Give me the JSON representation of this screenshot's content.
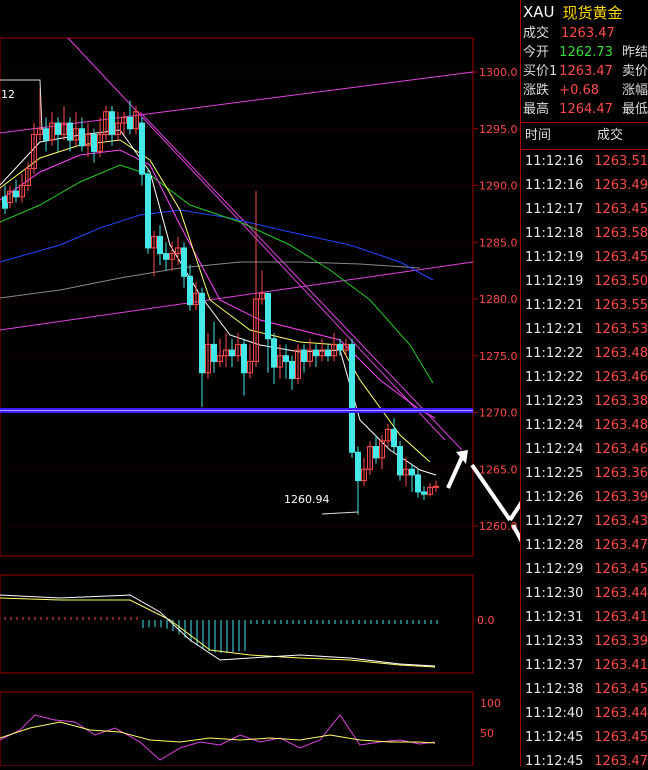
{
  "header": {
    "symbol": "XAU",
    "name": "现货黄金"
  },
  "quotes": [
    {
      "label": "成交",
      "value": "1263.47",
      "color": "red",
      "extra": ""
    },
    {
      "label": "今开",
      "value": "1262.73",
      "color": "green",
      "extra": "昨结"
    },
    {
      "label": "买价1",
      "value": "1263.47",
      "color": "red",
      "extra": "卖价"
    },
    {
      "label": "涨跌",
      "value": "+0.68",
      "color": "red",
      "extra": "涨幅"
    },
    {
      "label": "最高",
      "value": "1264.47",
      "color": "red",
      "extra": "最低"
    }
  ],
  "ticks_header": {
    "time": "时间",
    "price": "成交"
  },
  "ticks": [
    {
      "time": "11:12:16",
      "price": "1263.51"
    },
    {
      "time": "11:12:16",
      "price": "1263.49"
    },
    {
      "time": "11:12:17",
      "price": "1263.45"
    },
    {
      "time": "11:12:18",
      "price": "1263.58"
    },
    {
      "time": "11:12:19",
      "price": "1263.45"
    },
    {
      "time": "11:12:19",
      "price": "1263.50"
    },
    {
      "time": "11:12:21",
      "price": "1263.55"
    },
    {
      "time": "11:12:21",
      "price": "1263.53"
    },
    {
      "time": "11:12:22",
      "price": "1263.48"
    },
    {
      "time": "11:12:22",
      "price": "1263.46"
    },
    {
      "time": "11:12:23",
      "price": "1263.38"
    },
    {
      "time": "11:12:24",
      "price": "1263.48"
    },
    {
      "time": "11:12:24",
      "price": "1263.46"
    },
    {
      "time": "11:12:25",
      "price": "1263.36"
    },
    {
      "time": "11:12:26",
      "price": "1263.39"
    },
    {
      "time": "11:12:27",
      "price": "1263.43"
    },
    {
      "time": "11:12:28",
      "price": "1263.47"
    },
    {
      "time": "11:12:29",
      "price": "1263.45"
    },
    {
      "time": "11:12:30",
      "price": "1263.44"
    },
    {
      "time": "11:12:31",
      "price": "1263.41"
    },
    {
      "time": "11:12:33",
      "price": "1263.39"
    },
    {
      "time": "11:12:37",
      "price": "1263.41"
    },
    {
      "time": "11:12:38",
      "price": "1263.45"
    },
    {
      "time": "11:12:40",
      "price": "1263.44"
    },
    {
      "time": "11:12:45",
      "price": "1263.45"
    },
    {
      "time": "11:12:45",
      "price": "1263.47"
    }
  ],
  "price_axis": [
    "1300.0",
    "1295.0",
    "1290.0",
    "1285.0",
    "1280.0",
    "1275.0",
    "1270.0",
    "1265.0",
    "1260.0"
  ],
  "macd_axis": [
    "0.0"
  ],
  "osc_axis": [
    "100",
    "50"
  ],
  "annotations": {
    "low_label": "1260.94",
    "left_label": "12"
  },
  "colors": {
    "up": "#ff4a4a",
    "down": "#44e8e8",
    "grid": "#a00000",
    "ma5": "#ffffff",
    "ma10": "#ffff66",
    "ma20": "#ff44ff",
    "ma40": "#22cc22",
    "ma60": "#2244ff",
    "ma120": "#888888"
  }
}
